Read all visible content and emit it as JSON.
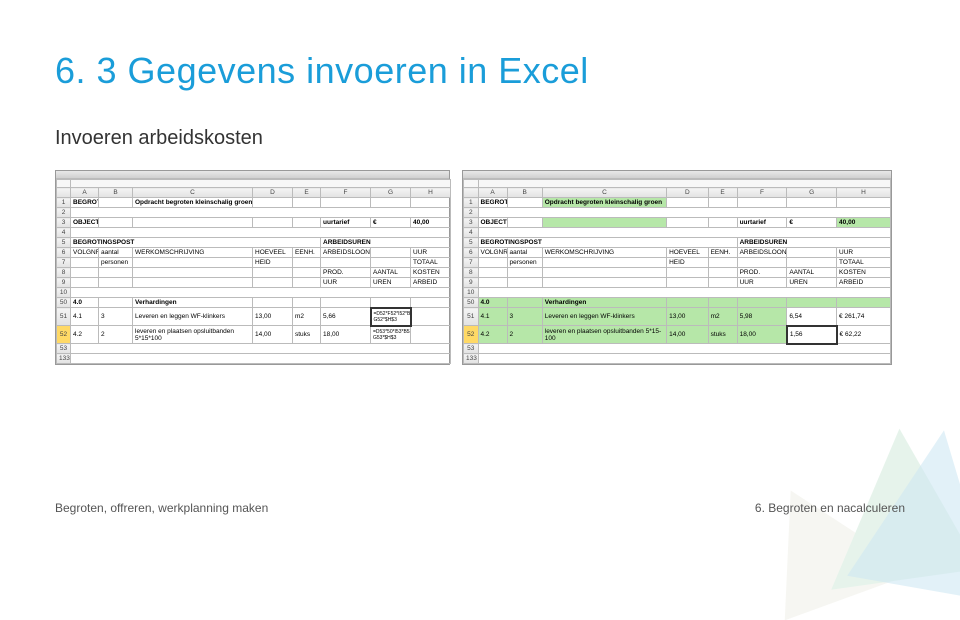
{
  "title": "6. 3 Gegevens invoeren in Excel",
  "subtitle": "Invoeren arbeidskosten",
  "footer_left": "Begroten, offreren, werkplanning maken",
  "footer_right": "6. Begroten en nacalculeren",
  "cols": {
    "A": "A",
    "B": "B",
    "C": "C",
    "D": "D",
    "E": "E",
    "F": "F",
    "G": "G",
    "H": "H"
  },
  "rows": {
    "r1": "1",
    "r2": "2",
    "r3": "3",
    "r4": "4",
    "r5": "5",
    "r6": "6",
    "r7": "7",
    "r8": "8",
    "r9": "9",
    "r10": "10",
    "r50": "50",
    "r51": "51",
    "r52": "52",
    "r53": "53",
    "r133": "133"
  },
  "labels": {
    "begroting": "BEGROTING",
    "opdracht": "Opdracht begroten kleinschalig groen",
    "object": "OBJECT :",
    "uurtarief": "uurtarief",
    "euro": "€",
    "tarief": "40,00",
    "begrotingspost": "BEGROTINGSPOST",
    "arbeidsuren": "ARBEIDSUREN",
    "volgnr": "VOLGNR.",
    "aantal": "aantal",
    "werkomschrijving": "WERKOMSCHRIJVING",
    "hoeveel": "HOEVEEL",
    "eenh": "EENH.",
    "arbeidsloon": "ARBEIDSLOON",
    "uur": "UUR",
    "personen": "personen",
    "heid": "HEID",
    "totaal": "TOTAAL",
    "prod": "PROD.",
    "aantal_caps": "AANTAL",
    "kosten": "KOSTEN",
    "uur2": "UUR",
    "uren": "UREN",
    "arbeid": "ARBEID"
  },
  "data_left": {
    "sec": "4.0",
    "sec_title": "Verhardingen",
    "r51_num": "4.1",
    "r51_aant": "3",
    "r51_desc": "Leveren en leggen WF-klinkers",
    "r51_hvl": "13,00",
    "r51_eenh": "m2",
    "r51_arbl": "5,66",
    "r51_formula": "=D52*F52*I52*B52 G52*$H$3",
    "r52_num": "4.2",
    "r52_aant": "2",
    "r52_desc": "leveren en plaatsen opsluitbanden 5*15*100",
    "r52_hvl": "14,00",
    "r52_eenh": "stuks",
    "r52_arbl": "18,00",
    "r52_formula": "=D53*50*I53*B53 G53*$H$3"
  },
  "data_right": {
    "sec": "4.0",
    "sec_title": "Verhardingen",
    "r51_num": "4.1",
    "r51_aant": "3",
    "r51_desc": "Leveren en leggen WF-klinkers",
    "r51_hvl": "13,00",
    "r51_eenh": "m2",
    "r51_arbl": "5,98",
    "r51_g": "6,54",
    "r51_h": "€ 261,74",
    "r52_num": "4.2",
    "r52_aant": "2",
    "r52_desc": "leveren en plaatsen opsluitbanden 5*15-100",
    "r52_hvl": "14,00",
    "r52_eenh": "stuks",
    "r52_arbl": "18,00",
    "r52_g": "1,56",
    "r52_h": "€ 62,22"
  }
}
